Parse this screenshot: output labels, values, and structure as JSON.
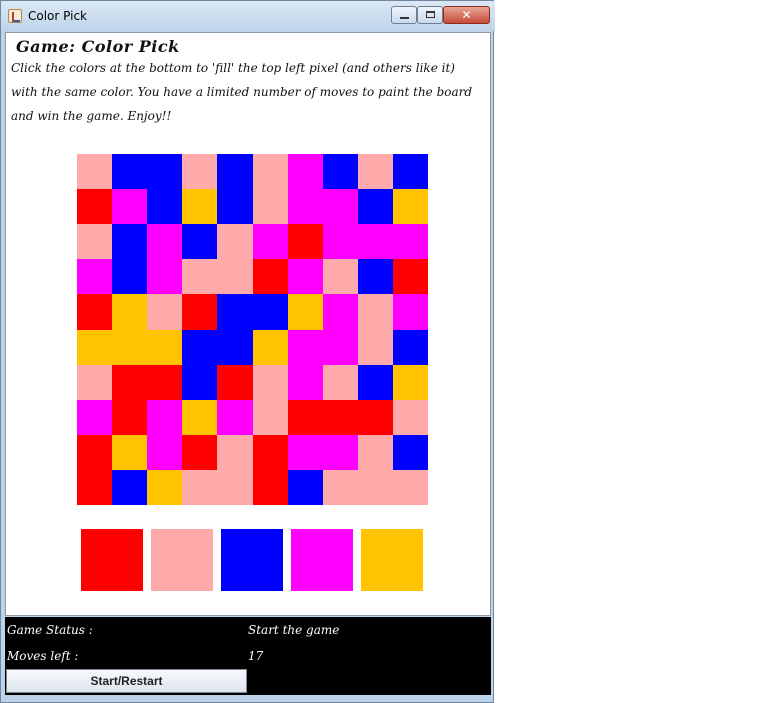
{
  "window": {
    "title": "Color Pick"
  },
  "game": {
    "title": "Game: Color Pick",
    "instructions": [
      "Click the colors at the bottom to 'fill' the top left pixel (and others like it)",
      "with the same color. You have a limited number of moves to paint the board",
      "and win the game. Enjoy!!"
    ]
  },
  "palette": {
    "R": "#ff0000",
    "P": "#ffaaaa",
    "B": "#0000ff",
    "M": "#ff00ff",
    "Y": "#ffc300"
  },
  "board": [
    "PBBPBPMBPB",
    "RMBYBPMMBY",
    "PBMBPMRMMM",
    "MBMPPRMPBR",
    "RYPRBBYMPM",
    "YYYBBYMMPB",
    "PRRBRPMPBY",
    "MRMYMPRRRP",
    "RYMRPRMMPB",
    "RBYPPRBPPP"
  ],
  "swatches": [
    "R",
    "P",
    "B",
    "M",
    "Y"
  ],
  "status": {
    "game_status_label": "Game Status :",
    "game_status_value": "Start the game",
    "moves_left_label": "Moves left :",
    "moves_left_value": "17",
    "restart_label": "Start/Restart"
  }
}
